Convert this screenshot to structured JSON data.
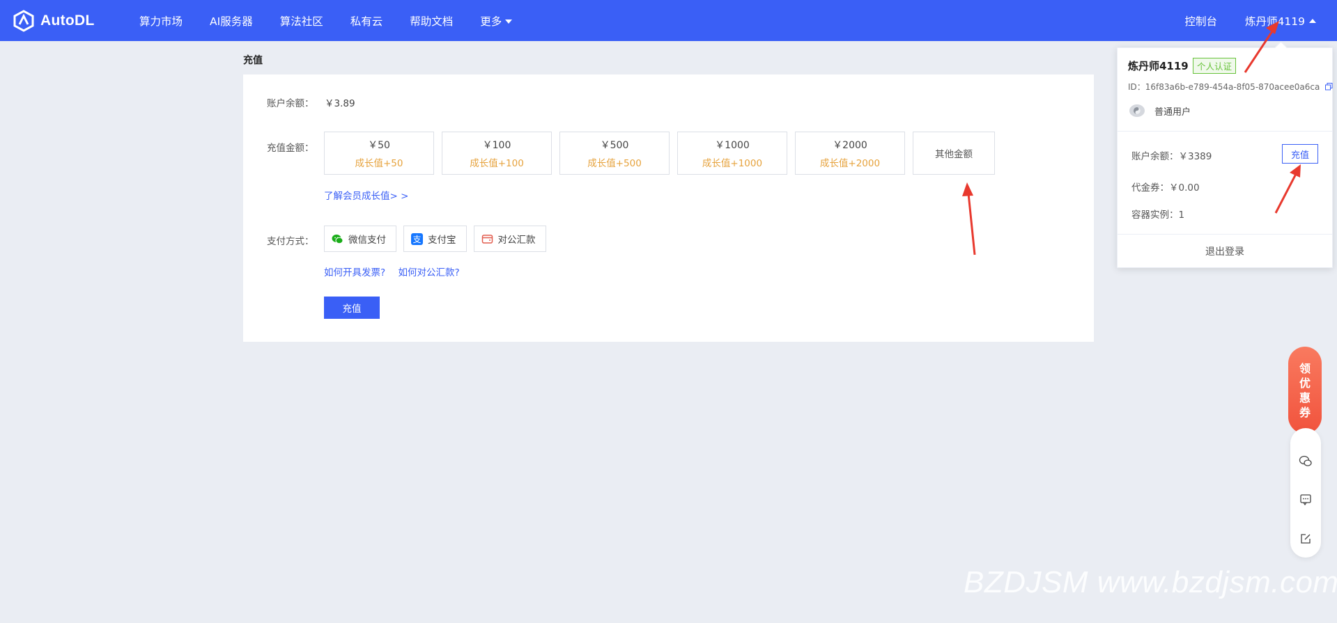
{
  "brand": {
    "name": "AutoDL"
  },
  "nav": {
    "items": [
      "算力市场",
      "AI服务器",
      "算法社区",
      "私有云",
      "帮助文档",
      "更多"
    ],
    "console": "控制台",
    "username": "炼丹师4119"
  },
  "page": {
    "heading": "充值",
    "balance_label": "账户余额：",
    "balance_value": "￥3.89",
    "amount_label": "充值金额：",
    "amounts": [
      {
        "value": "￥50",
        "growth": "成长值+50"
      },
      {
        "value": "￥100",
        "growth": "成长值+100"
      },
      {
        "value": "￥500",
        "growth": "成长值+500"
      },
      {
        "value": "￥1000",
        "growth": "成长值+1000"
      },
      {
        "value": "￥2000",
        "growth": "成长值+2000"
      }
    ],
    "other_amount": "其他金额",
    "learn_link": "了解会员成长值> >",
    "pay_label": "支付方式：",
    "pay_methods": [
      "微信支付",
      "支付宝",
      "对公汇款"
    ],
    "invoice_link": "如何开具发票?",
    "transfer_link": "如何对公汇款?",
    "submit": "充值"
  },
  "dropdown": {
    "name": "炼丹师4119",
    "badge": "个人认证",
    "id": "ID：16f83a6b-e789-454a-8f05-870acee0a6ca",
    "level": "普通用户",
    "balance": "账户余额：￥3389",
    "recharge": "充值",
    "voucher": "代金券：￥0.00",
    "instances": "容器实例：1",
    "logout": "退出登录"
  },
  "floating": {
    "coupon": [
      "领",
      "优",
      "惠",
      "券"
    ]
  },
  "watermark": "BZDJSM www.bzdjsm.com",
  "colors": {
    "primary": "#3a5ff6",
    "growth": "#e6a23c",
    "verified": "#67c23a",
    "arrow": "#e8392e"
  }
}
